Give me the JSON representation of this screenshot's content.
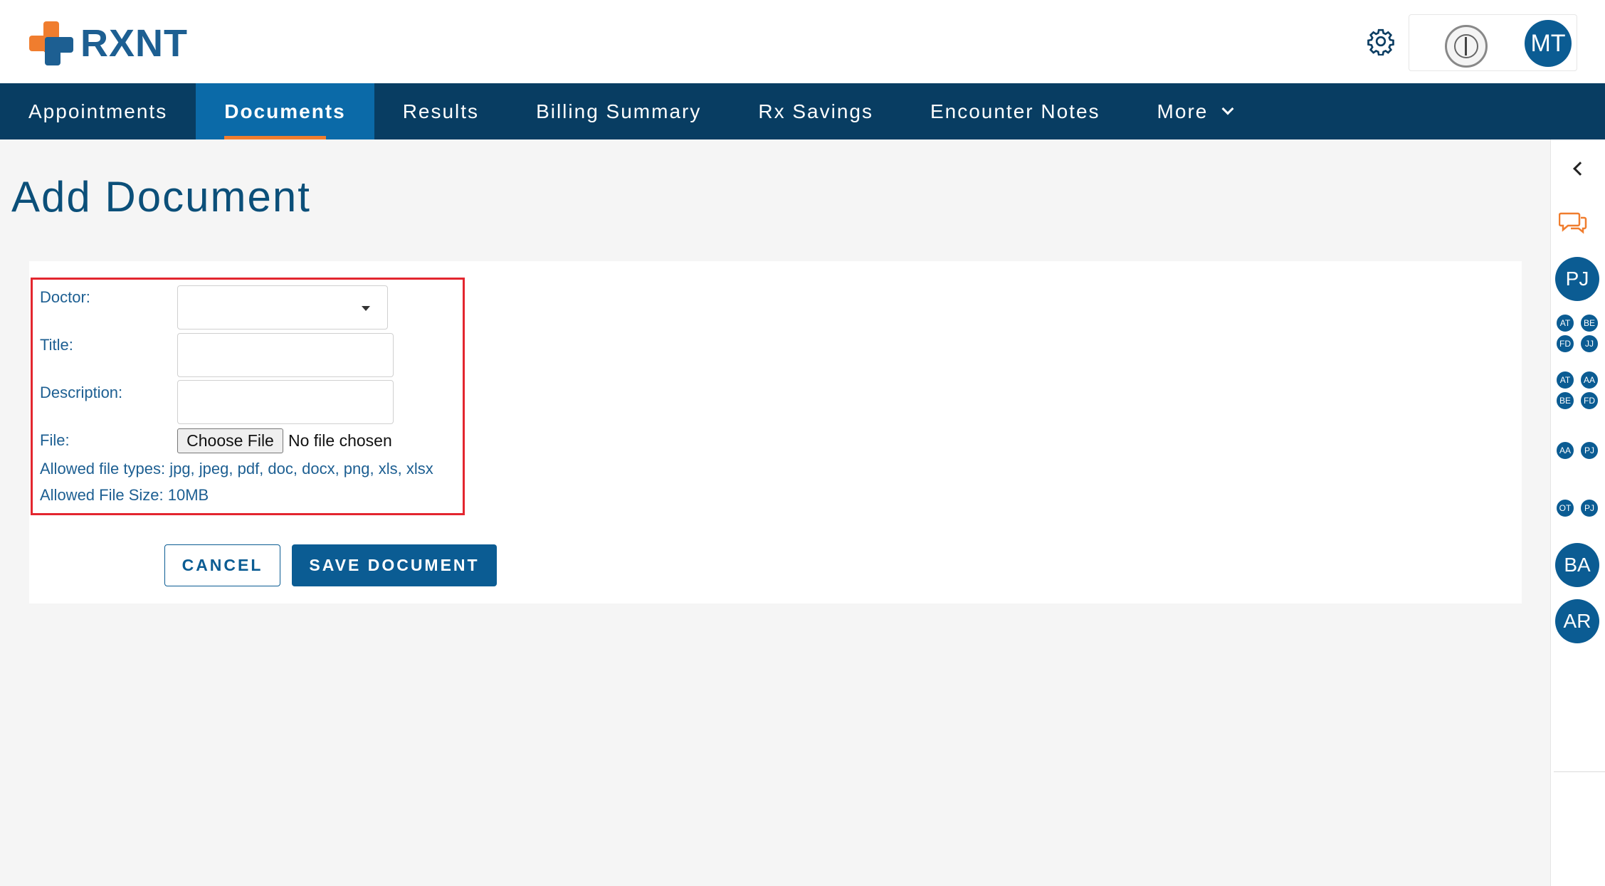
{
  "brand": {
    "name": "RXNT",
    "orange": "#f07d2e",
    "blue": "#1d5f92"
  },
  "header": {
    "settings_icon": "gear-icon",
    "practice_logo": "medical-seal",
    "user_initials": "MT"
  },
  "nav": {
    "items": [
      {
        "label": "Appointments",
        "active": false
      },
      {
        "label": "Documents",
        "active": true
      },
      {
        "label": "Results",
        "active": false
      },
      {
        "label": "Billing Summary",
        "active": false
      },
      {
        "label": "Rx Savings",
        "active": false
      },
      {
        "label": "Encounter Notes",
        "active": false
      },
      {
        "label": "More",
        "active": false,
        "has_dropdown": true
      }
    ]
  },
  "page": {
    "title": "Add Document"
  },
  "form": {
    "doctor_label": "Doctor:",
    "doctor_value": "",
    "title_label": "Title:",
    "title_value": "",
    "description_label": "Description:",
    "description_value": "",
    "file_label": "File:",
    "choose_file_label": "Choose File",
    "no_file_text": "No file chosen",
    "allowed_types": "Allowed file types: jpg, jpeg, pdf, doc, docx, png, xls, xlsx",
    "allowed_size": "Allowed File Size: 10MB",
    "cancel_label": "CANCEL",
    "save_label": "SAVE DOCUMENT"
  },
  "rail": {
    "collapse_icon": "chevron-left-icon",
    "chat_icon": "chat-bubbles-icon",
    "avatars_large": [
      "PJ",
      "BA",
      "AR"
    ],
    "group1": [
      "AT",
      "BE",
      "FD",
      "JJ"
    ],
    "group2": [
      "AT",
      "AA",
      "BE",
      "FD"
    ],
    "group3": [
      "AA",
      "PJ"
    ],
    "group4": [
      "OT",
      "PJ"
    ]
  }
}
